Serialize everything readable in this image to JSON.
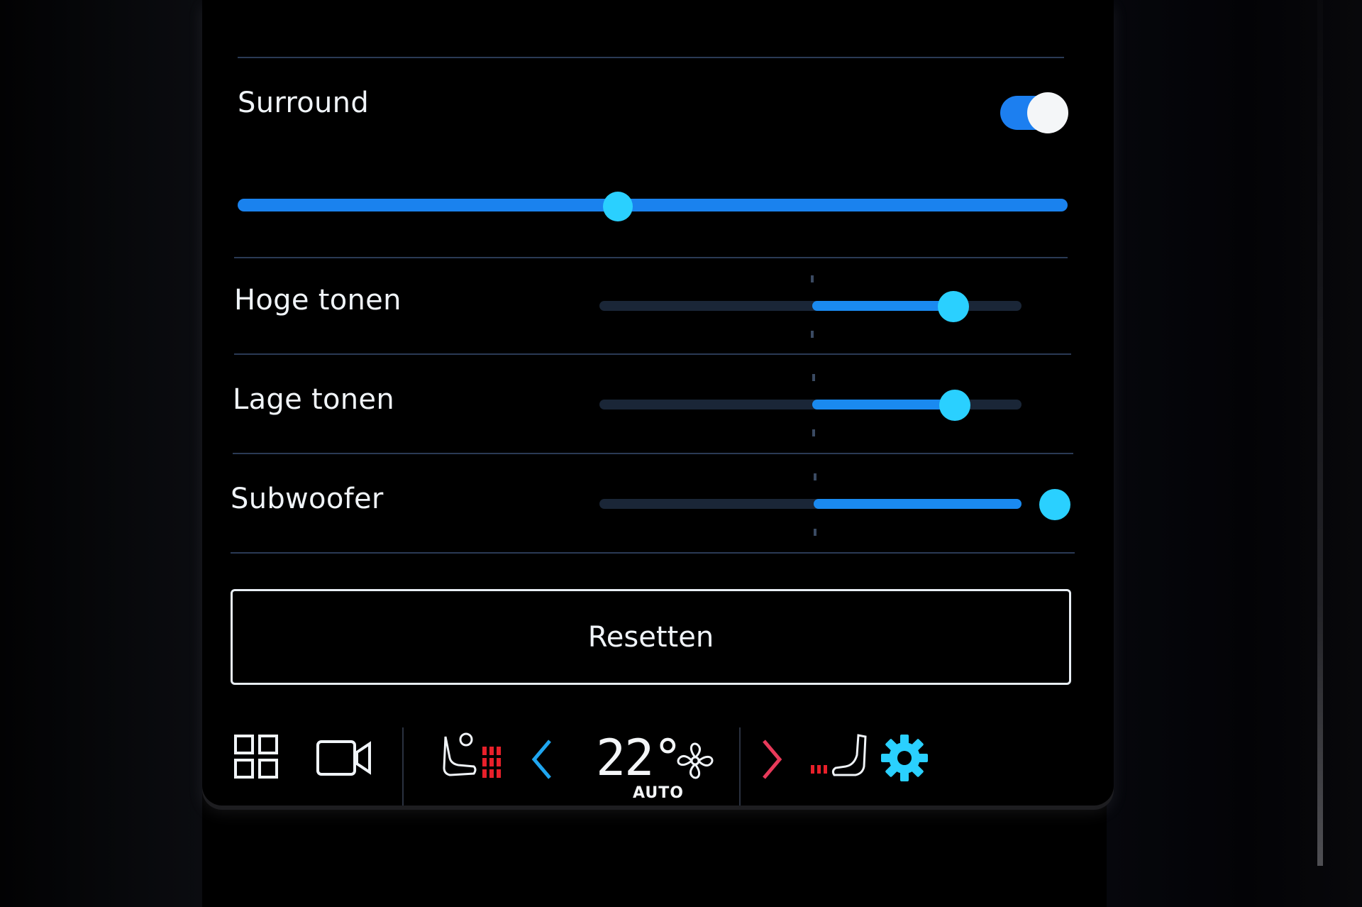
{
  "settings": {
    "surround": {
      "label": "Surround",
      "enabled": true,
      "level": 0.51
    },
    "eq": [
      {
        "label": "Hoge tonen",
        "value": 0.84
      },
      {
        "label": "Lage tonen",
        "value": 0.84
      },
      {
        "label": "Subwoofer",
        "value": 1.0
      }
    ],
    "reset_label": "Resetten"
  },
  "climate": {
    "temperature": "22°",
    "mode": "AUTO"
  },
  "colors": {
    "accent": "#1a82ee",
    "knob": "#2ad0ff",
    "heat": "#e8202a",
    "arrow_left": "#1fa6f0",
    "arrow_right": "#e83a5a",
    "gear": "#2ad0ff"
  },
  "icons": [
    "home-grid-icon",
    "camera-icon",
    "driver-seat-heat-icon",
    "chevron-left-icon",
    "fan-icon",
    "chevron-right-icon",
    "passenger-seat-heat-icon",
    "gear-icon"
  ]
}
